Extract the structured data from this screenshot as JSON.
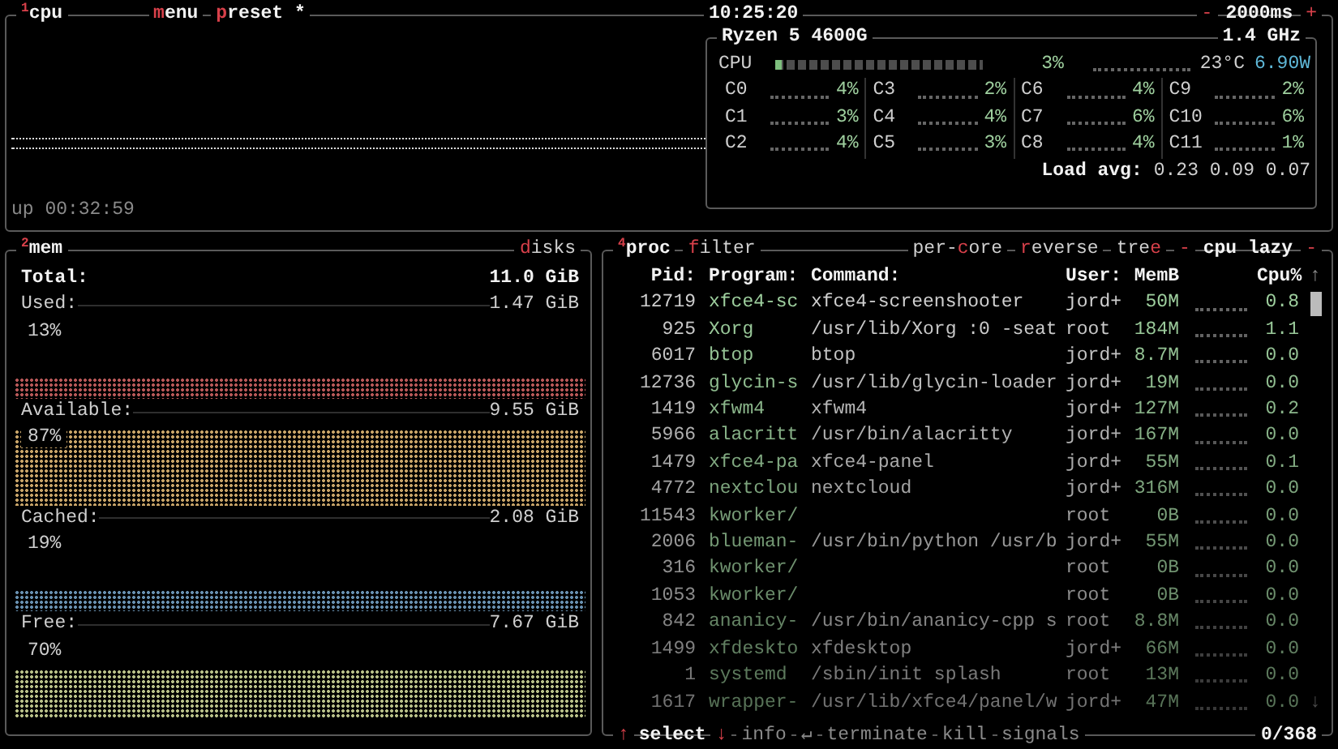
{
  "cpu_box": {
    "number": "1",
    "title": "cpu",
    "tabs": [
      {
        "key": "m",
        "post": "enu"
      },
      {
        "key": "p",
        "post": "reset *"
      }
    ],
    "clock": "10:25:20",
    "interval": {
      "minus": "-",
      "value": "2000ms",
      "plus": "+"
    },
    "uptime": "up 00:32:59",
    "processor": {
      "model": "Ryzen 5 4600G",
      "frequency": "1.4 GHz",
      "total": {
        "label": "CPU",
        "level": 0.03,
        "percent": "3%",
        "temperature": "23°C",
        "power": "6.90W"
      },
      "cores": [
        {
          "name": "C0",
          "percent": "4%"
        },
        {
          "name": "C1",
          "percent": "3%"
        },
        {
          "name": "C2",
          "percent": "4%"
        },
        {
          "name": "C3",
          "percent": "2%"
        },
        {
          "name": "C4",
          "percent": "4%"
        },
        {
          "name": "C5",
          "percent": "3%"
        },
        {
          "name": "C6",
          "percent": "4%"
        },
        {
          "name": "C7",
          "percent": "6%"
        },
        {
          "name": "C8",
          "percent": "4%"
        },
        {
          "name": "C9",
          "percent": "2%"
        },
        {
          "name": "C10",
          "percent": "6%"
        },
        {
          "name": "C11",
          "percent": "1%"
        }
      ],
      "load_avg": {
        "label": "Load avg:",
        "values": "0.23 0.09 0.07"
      }
    }
  },
  "mem_box": {
    "number": "2",
    "title": "mem",
    "disks_tab": {
      "key": "d",
      "post": "isks"
    },
    "total": {
      "label": "Total:",
      "value": "11.0 GiB"
    },
    "items": [
      {
        "label": "Used:",
        "value": "1.47 GiB",
        "percent": "13%",
        "color": "#b85858"
      },
      {
        "label": "Available:",
        "value": "9.55 GiB",
        "percent": "87%",
        "color": "#c8a468"
      },
      {
        "label": "Cached:",
        "value": "2.08 GiB",
        "percent": "19%",
        "color": "#6890b0"
      },
      {
        "label": "Free:",
        "value": "7.67 GiB",
        "percent": "70%",
        "color": "#b8c088"
      }
    ]
  },
  "proc_box": {
    "number": "4",
    "title": "proc",
    "options": [
      {
        "key": "f",
        "post": "ilter"
      },
      {
        "pre": "per-",
        "key": "c",
        "post": "ore"
      },
      {
        "key": "r",
        "post": "everse"
      },
      {
        "pre": "tre",
        "key": "e"
      }
    ],
    "sort": {
      "left": "-",
      "value": "cpu lazy",
      "right": "-"
    },
    "columns": [
      "Pid:",
      "Program:",
      "Command:",
      "User:",
      "MemB",
      "Cpu%"
    ],
    "scroll_up": "↑",
    "scroll_down": "↓",
    "rows": [
      {
        "pid": "12719",
        "program": "xfce4-sc",
        "command": "xfce4-screenshooter",
        "user": "jord+",
        "mem": "50M",
        "cpu": "0.8"
      },
      {
        "pid": "925",
        "program": "Xorg",
        "command": "/usr/lib/Xorg :0 -seat",
        "user": "root",
        "mem": "184M",
        "cpu": "1.1"
      },
      {
        "pid": "6017",
        "program": "btop",
        "command": "btop",
        "user": "jord+",
        "mem": "8.7M",
        "cpu": "0.0"
      },
      {
        "pid": "12736",
        "program": "glycin-s",
        "command": "/usr/lib/glycin-loader",
        "user": "jord+",
        "mem": "19M",
        "cpu": "0.0"
      },
      {
        "pid": "1419",
        "program": "xfwm4",
        "command": "xfwm4",
        "user": "jord+",
        "mem": "127M",
        "cpu": "0.2"
      },
      {
        "pid": "5966",
        "program": "alacritt",
        "command": "/usr/bin/alacritty",
        "user": "jord+",
        "mem": "167M",
        "cpu": "0.0"
      },
      {
        "pid": "1479",
        "program": "xfce4-pa",
        "command": "xfce4-panel",
        "user": "jord+",
        "mem": "55M",
        "cpu": "0.1"
      },
      {
        "pid": "4772",
        "program": "nextclou",
        "command": "nextcloud",
        "user": "jord+",
        "mem": "316M",
        "cpu": "0.0"
      },
      {
        "pid": "11543",
        "program": "kworker/",
        "user": "root",
        "mem": "0B",
        "cpu": "0.0"
      },
      {
        "pid": "2006",
        "program": "blueman-",
        "command": "/usr/bin/python /usr/b",
        "user": "jord+",
        "mem": "55M",
        "cpu": "0.0"
      },
      {
        "pid": "316",
        "program": "kworker/",
        "user": "root",
        "mem": "0B",
        "cpu": "0.0"
      },
      {
        "pid": "1053",
        "program": "kworker/",
        "user": "root",
        "mem": "0B",
        "cpu": "0.0"
      },
      {
        "pid": "842",
        "program": "ananicy-",
        "command": "/usr/bin/ananicy-cpp s",
        "user": "root",
        "mem": "8.8M",
        "cpu": "0.0"
      },
      {
        "pid": "1499",
        "program": "xfdeskto",
        "command": "xfdesktop",
        "user": "jord+",
        "mem": "66M",
        "cpu": "0.0"
      },
      {
        "pid": "1",
        "program": "systemd",
        "command": "/sbin/init splash",
        "user": "root",
        "mem": "13M",
        "cpu": "0.0"
      },
      {
        "pid": "1617",
        "program": "wrapper-",
        "command": "/usr/lib/xfce4/panel/w",
        "user": "jord+",
        "mem": "47M",
        "cpu": "0.0"
      }
    ],
    "footer": {
      "up": "↑",
      "select": "select",
      "down": "↓",
      "actions": [
        {
          "label": "info",
          "suffix": "↵"
        },
        {
          "label": "terminate"
        },
        {
          "label": "kill"
        },
        {
          "label": "signals"
        }
      ],
      "count": "0/368"
    }
  }
}
